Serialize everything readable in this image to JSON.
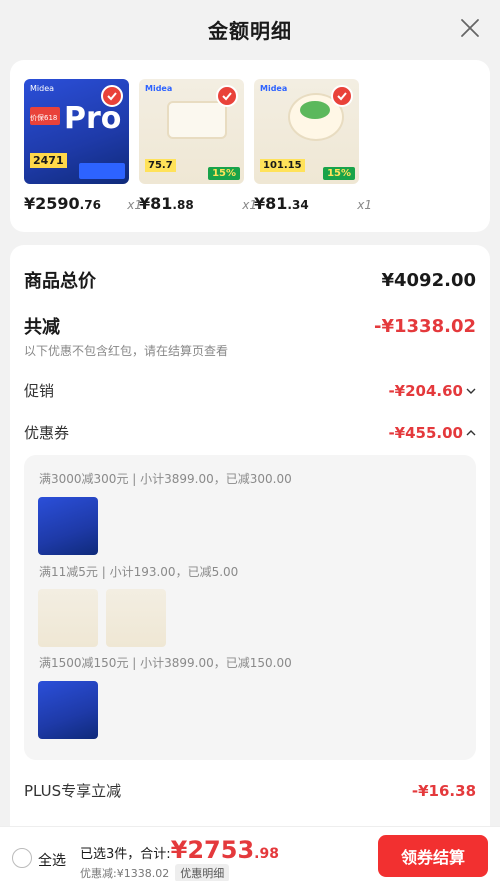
{
  "header": {
    "title": "金额明细"
  },
  "products": [
    {
      "price_int": "¥2590",
      "price_cents": ".76",
      "qty": "x1",
      "brand": "Midea",
      "text": "Pro",
      "promo": "价保618",
      "price_tag": "2471"
    },
    {
      "price_int": "¥81",
      "price_cents": ".88",
      "qty": "x1",
      "brand": "Midea",
      "price_tag": "75.7",
      "promo": "15%"
    },
    {
      "price_int": "¥81",
      "price_cents": ".34",
      "qty": "x1",
      "brand": "Midea",
      "price_tag": "101.15",
      "promo": "15%"
    }
  ],
  "summary": {
    "total_label": "商品总价",
    "total_value": "¥4092.00",
    "discount_label": "共减",
    "discount_value": "-¥1338.02",
    "note": "以下优惠不包含红包，请在结算页查看",
    "promo_label": "促销",
    "promo_value": "-¥204.60",
    "coupon_label": "优惠券",
    "coupon_value": "-¥455.00",
    "plus_label": "PLUS专享立减",
    "plus_value": "-¥16.38"
  },
  "coupons": [
    {
      "text": "满3000减300元 | 小计3899.00，已减300.00"
    },
    {
      "text": "满11减5元 | 小计193.00，已减5.00"
    },
    {
      "text": "满1500减150元 | 小计3899.00，已减150.00"
    }
  ],
  "bottom": {
    "select_all": "全选",
    "selected": "已选3件，合计:",
    "total_int": "¥2753",
    "total_cents": ".98",
    "saved": "优惠减:¥1338.02",
    "detail": "优惠明细",
    "checkout": "领券结算"
  },
  "colors": {
    "accent": "#e4393c",
    "button": "#f23030"
  }
}
